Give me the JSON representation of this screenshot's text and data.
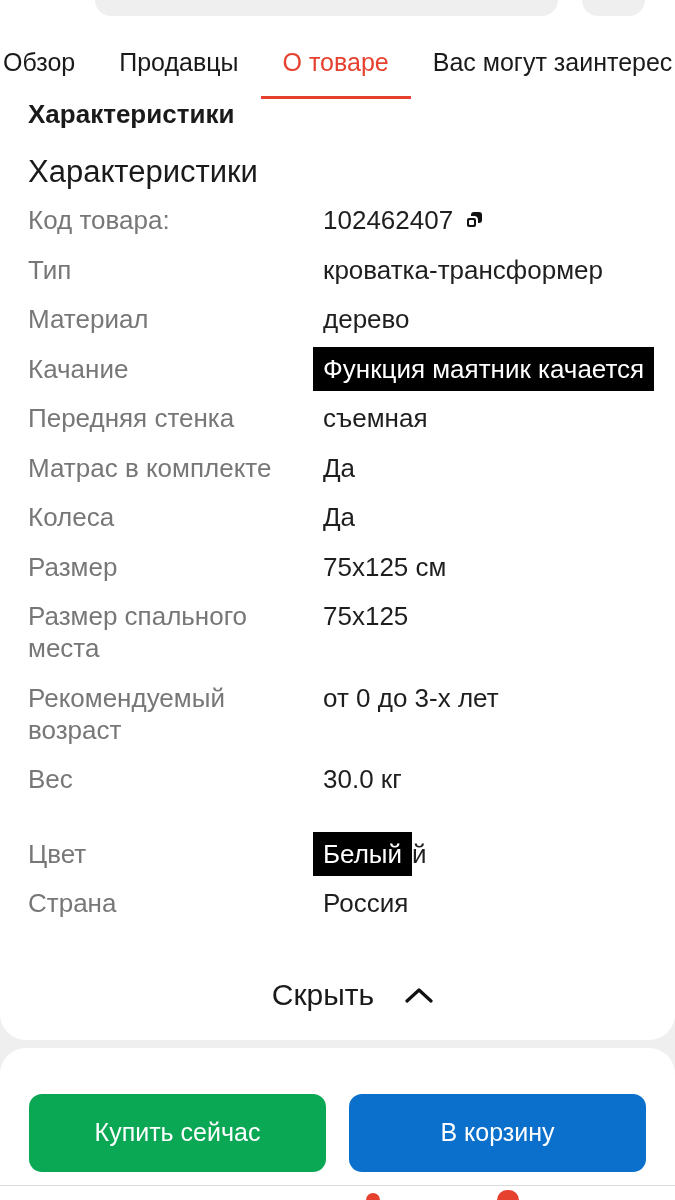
{
  "tabs": [
    {
      "label": "Обзор",
      "selected": false
    },
    {
      "label": "Продавцы",
      "selected": false
    },
    {
      "label": "О товаре",
      "selected": true
    },
    {
      "label": "Вас могут заинтерес",
      "selected": false
    }
  ],
  "scrolled_heading": "Характеристики",
  "specs": {
    "title": "Характеристики",
    "rows": [
      {
        "label": "Код товара:",
        "value": "102462407",
        "kind": "copyable"
      },
      {
        "label": "Тип",
        "value": "кроватка-трансформер",
        "kind": "plain"
      },
      {
        "label": "Материал",
        "value": "дерево",
        "kind": "plain"
      },
      {
        "label": "Качание",
        "value": "Функция маятник качается",
        "kind": "highlighted"
      },
      {
        "label": "Передняя стенка",
        "value": "съемная",
        "kind": "plain"
      },
      {
        "label": "Матрас в комплекте",
        "value": "Да",
        "kind": "plain"
      },
      {
        "label": "Колеса",
        "value": "Да",
        "kind": "plain"
      },
      {
        "label": "Размер",
        "value": "75x125 см",
        "kind": "plain"
      },
      {
        "label": "Размер спального места",
        "value": "75x125",
        "kind": "plain"
      },
      {
        "label": "Рекомендуемый возраст",
        "value": "от 0 до 3-х лет",
        "kind": "plain"
      },
      {
        "label": "Вес",
        "value": "30.0 кг",
        "kind": "plain"
      },
      {
        "label": "Цвет",
        "value": "Белый",
        "kind": "highlighted",
        "remnant": "й"
      },
      {
        "label": "Страна",
        "value": "Россия",
        "kind": "plain"
      }
    ]
  },
  "collapse_button": {
    "label": "Скрыть",
    "expanded": true
  },
  "actions": [
    {
      "label": "Купить сейчас",
      "color": "#0aa854"
    },
    {
      "label": "В корзину",
      "color": "#0b70cb"
    }
  ]
}
